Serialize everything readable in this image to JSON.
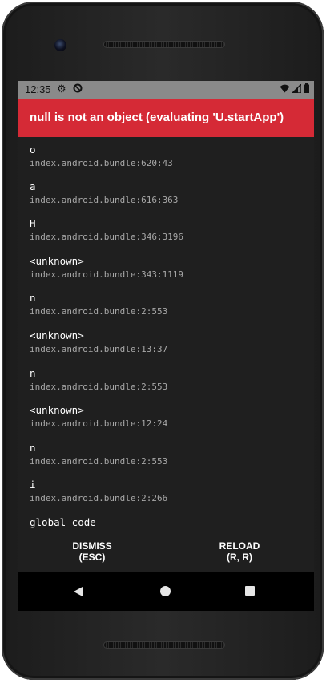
{
  "status_bar": {
    "time": "12:35",
    "left_icons": [
      "settings-gear-icon",
      "data-saver-icon"
    ],
    "right_icons": [
      "wifi-icon",
      "signal-icon",
      "battery-icon"
    ]
  },
  "error": {
    "title": "null is not an object (evaluating 'U.startApp')",
    "background_color": "#d52a36"
  },
  "stack_frames": [
    {
      "name": "o",
      "location": "index.android.bundle:620:43"
    },
    {
      "name": "a",
      "location": "index.android.bundle:616:363"
    },
    {
      "name": "H",
      "location": "index.android.bundle:346:3196"
    },
    {
      "name": "<unknown>",
      "location": "index.android.bundle:343:1119"
    },
    {
      "name": "n",
      "location": "index.android.bundle:2:553"
    },
    {
      "name": "<unknown>",
      "location": "index.android.bundle:13:37"
    },
    {
      "name": "n",
      "location": "index.android.bundle:2:553"
    },
    {
      "name": "<unknown>",
      "location": "index.android.bundle:12:24"
    },
    {
      "name": "n",
      "location": "index.android.bundle:2:553"
    },
    {
      "name": "i",
      "location": "index.android.bundle:2:266"
    },
    {
      "name": "global code",
      "location": ""
    }
  ],
  "footer": {
    "dismiss_label": "DISMISS",
    "dismiss_shortcut": "(ESC)",
    "reload_label": "RELOAD",
    "reload_shortcut": "(R, R)"
  },
  "nav_bar": {
    "icons": [
      "back-icon",
      "home-icon",
      "recents-icon"
    ]
  }
}
